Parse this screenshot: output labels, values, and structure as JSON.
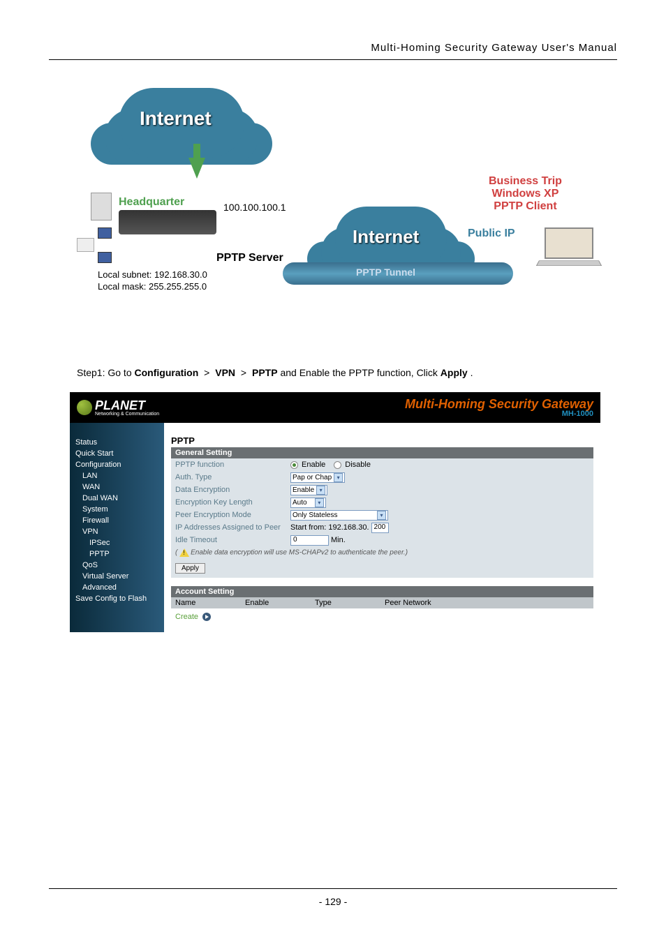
{
  "header": "Multi-Homing Security Gateway User's Manual",
  "diagram": {
    "cloud1": "Internet",
    "cloud2": "Internet",
    "headquarter": "Headquarter",
    "wan_ip": "100.100.100.1",
    "pptp_server": "PPTP Server",
    "local_subnet": "Local subnet: 192.168.30.0",
    "local_mask": "Local mask: 255.255.255.0",
    "business_trip": "Business Trip",
    "win_xp": "Windows XP",
    "pptp_client": "PPTP Client",
    "public_ip": "Public IP",
    "tunnel": "PPTP Tunnel"
  },
  "step": {
    "prefix": "Step1: Go to ",
    "path1": "Configuration",
    "path2": "VPN",
    "path3": "PPTP",
    "suffix": " and Enable the PPTP function, Click ",
    "apply": "Apply",
    "dot": "."
  },
  "admin": {
    "logo": "PLANET",
    "logo_sub": "Networking & Communication",
    "title": "Multi-Homing Security Gateway",
    "model": "MH-1000",
    "sidebar": {
      "status": "Status",
      "quick_start": "Quick Start",
      "configuration": "Configuration",
      "lan": "LAN",
      "wan": "WAN",
      "dual_wan": "Dual WAN",
      "system": "System",
      "firewall": "Firewall",
      "vpn": "VPN",
      "ipsec": "IPSec",
      "pptp": "PPTP",
      "qos": "QoS",
      "virtual_server": "Virtual Server",
      "advanced": "Advanced",
      "save_config": "Save Config to Flash"
    },
    "pptp": {
      "title": "PPTP",
      "general": "General Setting",
      "rows": {
        "function": "PPTP function",
        "enable": "Enable",
        "disable": "Disable",
        "auth_type": "Auth. Type",
        "auth_val": "Pap or Chap",
        "data_enc": "Data Encryption",
        "data_enc_val": "Enable",
        "key_len": "Encryption Key Length",
        "key_len_val": "Auto",
        "peer_mode": "Peer Encryption Mode",
        "peer_mode_val": "Only Stateless",
        "ip_assigned": "IP Addresses Assigned to Peer",
        "start_from": "Start from: 192.168.30.",
        "start_val": "200",
        "idle": "Idle Timeout",
        "idle_val": "0",
        "idle_unit": "Min."
      },
      "warn": "Enable data encryption will use MS-CHAPv2 to authenticate the peer.",
      "apply": "Apply",
      "account": {
        "title": "Account Setting",
        "name": "Name",
        "enable": "Enable",
        "type": "Type",
        "peer_network": "Peer Network",
        "create": "Create"
      }
    }
  },
  "footer": "- 129 -"
}
